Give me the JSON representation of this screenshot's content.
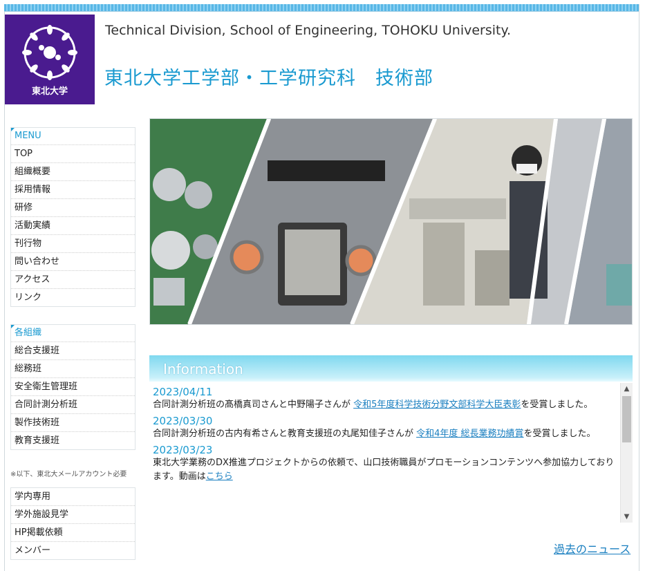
{
  "header": {
    "logo_text": "東北大学",
    "title_en": "Technical Division, School of Engineering, TOHOKU University.",
    "title_jp": "東北大学工学部・工学研究科　技術部"
  },
  "menu": {
    "heading": "MENU",
    "items": [
      "TOP",
      "組織概要",
      "採用情報",
      "研修",
      "活動実績",
      "刊行物",
      "問い合わせ",
      "アクセス",
      "リンク"
    ]
  },
  "groups": {
    "heading": "各組織",
    "items": [
      "総合支援班",
      "総務班",
      "安全衛生管理班",
      "合同計測分析班",
      "製作技術班",
      "教育支援班"
    ]
  },
  "note": "※以下、東北大メールアカウント必要",
  "internal": {
    "items": [
      "学内専用",
      "学外施設見学",
      "HP掲載依頼",
      "メンバー"
    ]
  },
  "information": {
    "heading": "Information",
    "news": [
      {
        "date": "2023/04/11",
        "before": "合同計測分析班の髙橋真司さんと中野陽子さんが ",
        "link": "令和5年度科学技術分野文部科学大臣表彰",
        "after": "を受賞しました。"
      },
      {
        "date": "2023/03/30",
        "before": "合同計測分析班の古内有希さんと教育支援班の丸尾知佳子さんが ",
        "link": "令和4年度 総長業務功績賞",
        "after": "を受賞しました。"
      },
      {
        "date": "2023/03/23",
        "before": "東北大学業務のDX推進プロジェクトからの依頼で、山口技術職員がプロモーションコンテンツへ参加協力しております。動画は",
        "link": "こちら",
        "after": ""
      }
    ],
    "past_news": "過去のニュース"
  }
}
